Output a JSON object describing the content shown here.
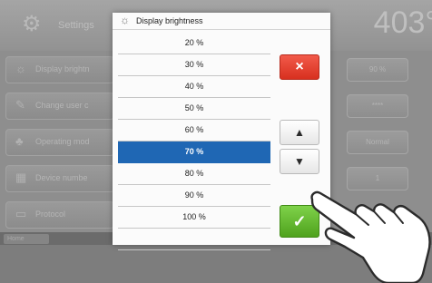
{
  "background": {
    "title": "Settings",
    "temperature": "403°",
    "rows": [
      {
        "label": "Display brightn",
        "value": "90 %",
        "icon": "brightness-icon"
      },
      {
        "label": "Change user c",
        "value": "****",
        "icon": "user-edit-icon"
      },
      {
        "label": "Operating mod",
        "value": "Normal",
        "icon": "operating-mode-icon"
      },
      {
        "label": "Device numbe",
        "value": "1",
        "icon": "device-number-icon"
      },
      {
        "label": "Protocol",
        "value": "",
        "icon": "protocol-icon"
      }
    ],
    "home_label": "Home"
  },
  "dialog": {
    "title": "Display brightness",
    "title_icon": "brightness-icon",
    "options": [
      "20 %",
      "30 %",
      "40 %",
      "50 %",
      "60 %",
      "70 %",
      "80 %",
      "90 %",
      "100 %"
    ],
    "selected": "70 %",
    "cancel_symbol": "×",
    "up_symbol": "▲",
    "down_symbol": "▼",
    "confirm_symbol": "✓"
  },
  "colors": {
    "selection": "#1f67b4",
    "cancel": "#e23b2b",
    "confirm": "#5cb22a"
  }
}
